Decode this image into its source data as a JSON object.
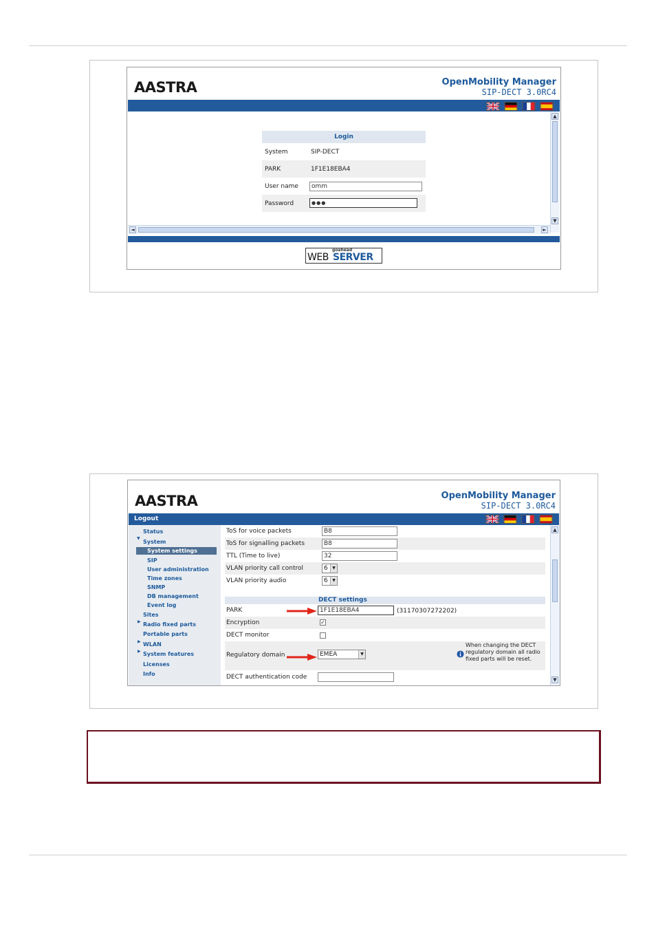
{
  "brand": {
    "logo_text": "AASTRA",
    "product_title": "OpenMobility Manager",
    "product_version": "SIP-DECT 3.0RC4"
  },
  "flags": [
    "flag-uk-icon",
    "flag-de-icon",
    "flag-fr-icon",
    "flag-es-icon"
  ],
  "colors": {
    "header_bar": "#235a9c",
    "link_blue": "#1d5a9b",
    "note_border": "#6a1020",
    "arrow_red": "#e0261b"
  },
  "login": {
    "title": "Login",
    "rows": [
      {
        "label": "System",
        "value": "SIP-DECT"
      },
      {
        "label": "PARK",
        "value": "1F1E18EBA4"
      },
      {
        "label": "User name",
        "value": "omm"
      },
      {
        "label": "Password",
        "value": "●●●"
      }
    ]
  },
  "webserver": {
    "small": "goahead",
    "web": "WEB",
    "server": "SERVER"
  },
  "config": {
    "logout": "Logout",
    "nav": [
      {
        "label": "Status"
      },
      {
        "label": "System",
        "expanded": true
      },
      {
        "label": "System settings",
        "selected": true
      },
      {
        "label": "SIP"
      },
      {
        "label": "User administration"
      },
      {
        "label": "Time zones"
      },
      {
        "label": "SNMP"
      },
      {
        "label": "DB management"
      },
      {
        "label": "Event log"
      },
      {
        "label": "Sites"
      },
      {
        "label": "Radio fixed parts",
        "arrow": true
      },
      {
        "label": "Portable parts"
      },
      {
        "label": "WLAN",
        "arrow": true
      },
      {
        "label": "System features",
        "arrow": true
      },
      {
        "label": "Licenses"
      },
      {
        "label": "Info"
      }
    ],
    "fields": {
      "tos_voice": {
        "label": "ToS for voice packets",
        "value": "B8"
      },
      "tos_signalling": {
        "label": "ToS for signalling packets",
        "value": "B8"
      },
      "ttl": {
        "label": "TTL (Time to live)",
        "value": "32"
      },
      "vlan_call": {
        "label": "VLAN priority call control",
        "value": "6"
      },
      "vlan_audio": {
        "label": "VLAN priority audio",
        "value": "6"
      }
    },
    "dect_header": "DECT settings",
    "park": {
      "label": "PARK",
      "value": "1F1E18EBA4",
      "extra": "(31170307272202)"
    },
    "encryption": {
      "label": "Encryption",
      "checked": true
    },
    "dect_monitor": {
      "label": "DECT monitor",
      "checked": false
    },
    "regulatory": {
      "label": "Regulatory domain",
      "value": "EMEA",
      "note": "When changing the DECT regulatory domain all radio fixed parts will be reset."
    },
    "dect_auth": {
      "label": "DECT authentication code",
      "value": ""
    }
  }
}
